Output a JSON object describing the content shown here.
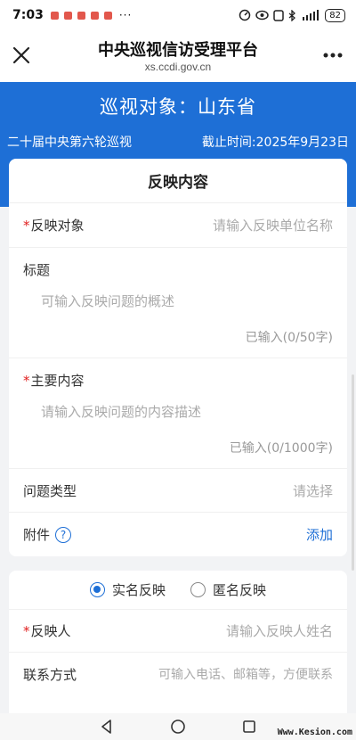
{
  "status_bar": {
    "time": "7:03",
    "dots": "···",
    "battery": "82"
  },
  "nav": {
    "title": "中央巡视信访受理平台",
    "url": "xs.ccdi.gov.cn",
    "close_icon": "close-icon",
    "more_icon": "more-icon"
  },
  "banner": {
    "title": "巡视对象：山东省",
    "round": "二十届中央第六轮巡视",
    "deadline": "截止时间:2025年9月23日"
  },
  "report_card": {
    "header": "反映内容",
    "target_label": "反映对象",
    "target_placeholder": "请输入反映单位名称",
    "title_label": "标题",
    "title_placeholder": "可输入反映问题的概述",
    "title_counter": "已输入(0/50字)",
    "content_label": "主要内容",
    "content_placeholder": "请输入反映问题的内容描述",
    "content_counter": "已输入(0/1000字)",
    "type_label": "问题类型",
    "type_value": "请选择",
    "attach_label": "附件",
    "attach_help": "?",
    "attach_action": "添加",
    "required_mark": "*"
  },
  "person_card": {
    "real_name_option": "实名反映",
    "anonymous_option": "匿名反映",
    "selected": "实名反映",
    "reporter_label": "反映人",
    "reporter_placeholder": "请输入反映人姓名",
    "contact_label": "联系方式",
    "contact_placeholder": "可输入电话、邮箱等，方便联系"
  },
  "watermark": "Www.Kesion.com",
  "colors": {
    "accent": "#1e6fd6",
    "required": "#e02020"
  }
}
